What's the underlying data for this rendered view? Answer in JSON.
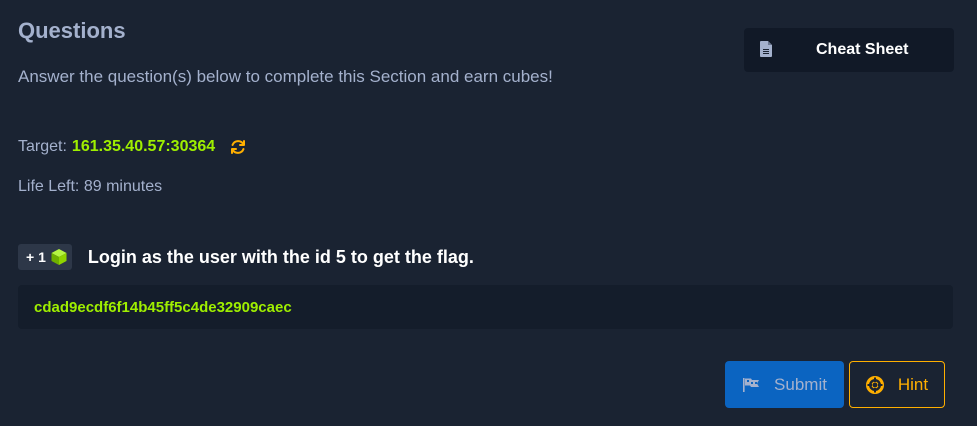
{
  "section": {
    "title": "Questions",
    "subtitle": "Answer the question(s) below to complete this Section and earn cubes!"
  },
  "cheat_sheet": {
    "label": "Cheat Sheet",
    "icon": "document-icon"
  },
  "target": {
    "label": "Target:",
    "value": "161.35.40.57:30364",
    "refresh_icon": "refresh-icon"
  },
  "life": {
    "text": "Life Left: 89 minutes"
  },
  "question": {
    "reward": "+ 1",
    "reward_icon": "cube-icon",
    "text": "Login as the user with the id 5 to get the flag.",
    "answer_value": "cdad9ecdf6f14b45ff5c4de32909caec"
  },
  "actions": {
    "submit_label": "Submit",
    "submit_icon": "flag-icon",
    "hint_label": "Hint",
    "hint_icon": "lifebuoy-icon"
  },
  "colors": {
    "background": "#1a2332",
    "accent_green": "#9fef00",
    "submit_blue": "#0b64c1",
    "hint_orange": "#ffaf00"
  }
}
